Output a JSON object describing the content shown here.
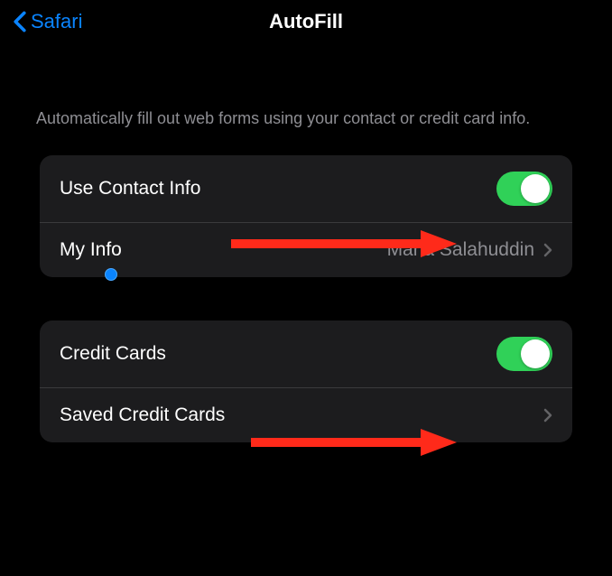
{
  "nav": {
    "back_label": "Safari",
    "title": "AutoFill"
  },
  "description": "Automatically fill out web forms using your contact or credit card info.",
  "group1": {
    "use_contact_label": "Use Contact Info",
    "use_contact_on": true,
    "my_info_label": "My Info",
    "my_info_value": "Maria Salahuddin"
  },
  "group2": {
    "credit_cards_label": "Credit Cards",
    "credit_cards_on": true,
    "saved_label": "Saved Credit Cards"
  },
  "colors": {
    "accent_blue": "#0a84ff",
    "toggle_green": "#30d158",
    "arrow_red": "#ff2a1a"
  }
}
